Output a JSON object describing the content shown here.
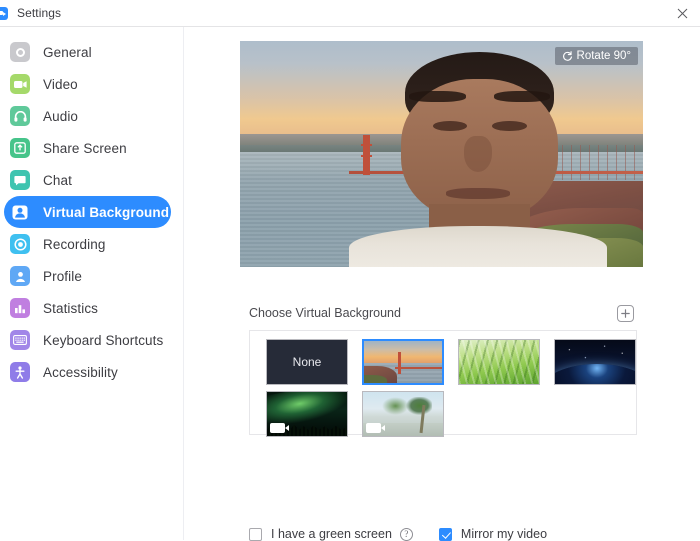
{
  "window": {
    "title": "Settings",
    "app_icon": "zoom-logo",
    "close_label": "✕"
  },
  "sidebar": {
    "items": [
      {
        "label": "General",
        "icon": "gear-icon",
        "color": "#c9c9cd",
        "active": false
      },
      {
        "label": "Video",
        "icon": "video-camera-icon",
        "color": "#a5d96a",
        "active": false
      },
      {
        "label": "Audio",
        "icon": "headphones-icon",
        "color": "#5fc99a",
        "active": false
      },
      {
        "label": "Share Screen",
        "icon": "share-screen-icon",
        "color": "#46c48a",
        "active": false
      },
      {
        "label": "Chat",
        "icon": "chat-bubble-icon",
        "color": "#3fc4b0",
        "active": false
      },
      {
        "label": "Virtual Background",
        "icon": "virtual-background-icon",
        "color": "#2d8cff",
        "active": true
      },
      {
        "label": "Recording",
        "icon": "record-circle-icon",
        "color": "#3fc0f0",
        "active": false
      },
      {
        "label": "Profile",
        "icon": "person-icon",
        "color": "#5fa8f5",
        "active": false
      },
      {
        "label": "Statistics",
        "icon": "bar-chart-icon",
        "color": "#c07fe0",
        "active": false
      },
      {
        "label": "Keyboard Shortcuts",
        "icon": "keyboard-icon",
        "color": "#a186e8",
        "active": false
      },
      {
        "label": "Accessibility",
        "icon": "accessibility-icon",
        "color": "#8f7ce8",
        "active": false
      }
    ]
  },
  "main": {
    "preview": {
      "rotate_button_label": "Rotate 90°",
      "rotate_icon": "rotate-icon"
    },
    "choose_section": {
      "label": "Choose Virtual Background",
      "add_button_icon": "plus-box-icon"
    },
    "backgrounds": [
      {
        "name": "None",
        "type": "none",
        "selected": false,
        "is_video": false
      },
      {
        "name": "Golden Gate Bridge",
        "type": "image",
        "selected": true,
        "is_video": false
      },
      {
        "name": "Grass",
        "type": "image",
        "selected": false,
        "is_video": false
      },
      {
        "name": "Earth from Space",
        "type": "image",
        "selected": false,
        "is_video": false
      },
      {
        "name": "Aurora Borealis",
        "type": "video",
        "selected": false,
        "is_video": true
      },
      {
        "name": "Beach with Palms",
        "type": "video",
        "selected": false,
        "is_video": true
      }
    ],
    "options": {
      "green_screen": {
        "label": "I have a green screen",
        "checked": false,
        "help_icon": "question-mark-icon",
        "help_glyph": "?"
      },
      "mirror_video": {
        "label": "Mirror my video",
        "checked": true
      }
    }
  },
  "colors": {
    "accent": "#2d8cff",
    "text": "#3d3d42",
    "muted": "#4a4a4f",
    "border": "#e6e6e9"
  }
}
